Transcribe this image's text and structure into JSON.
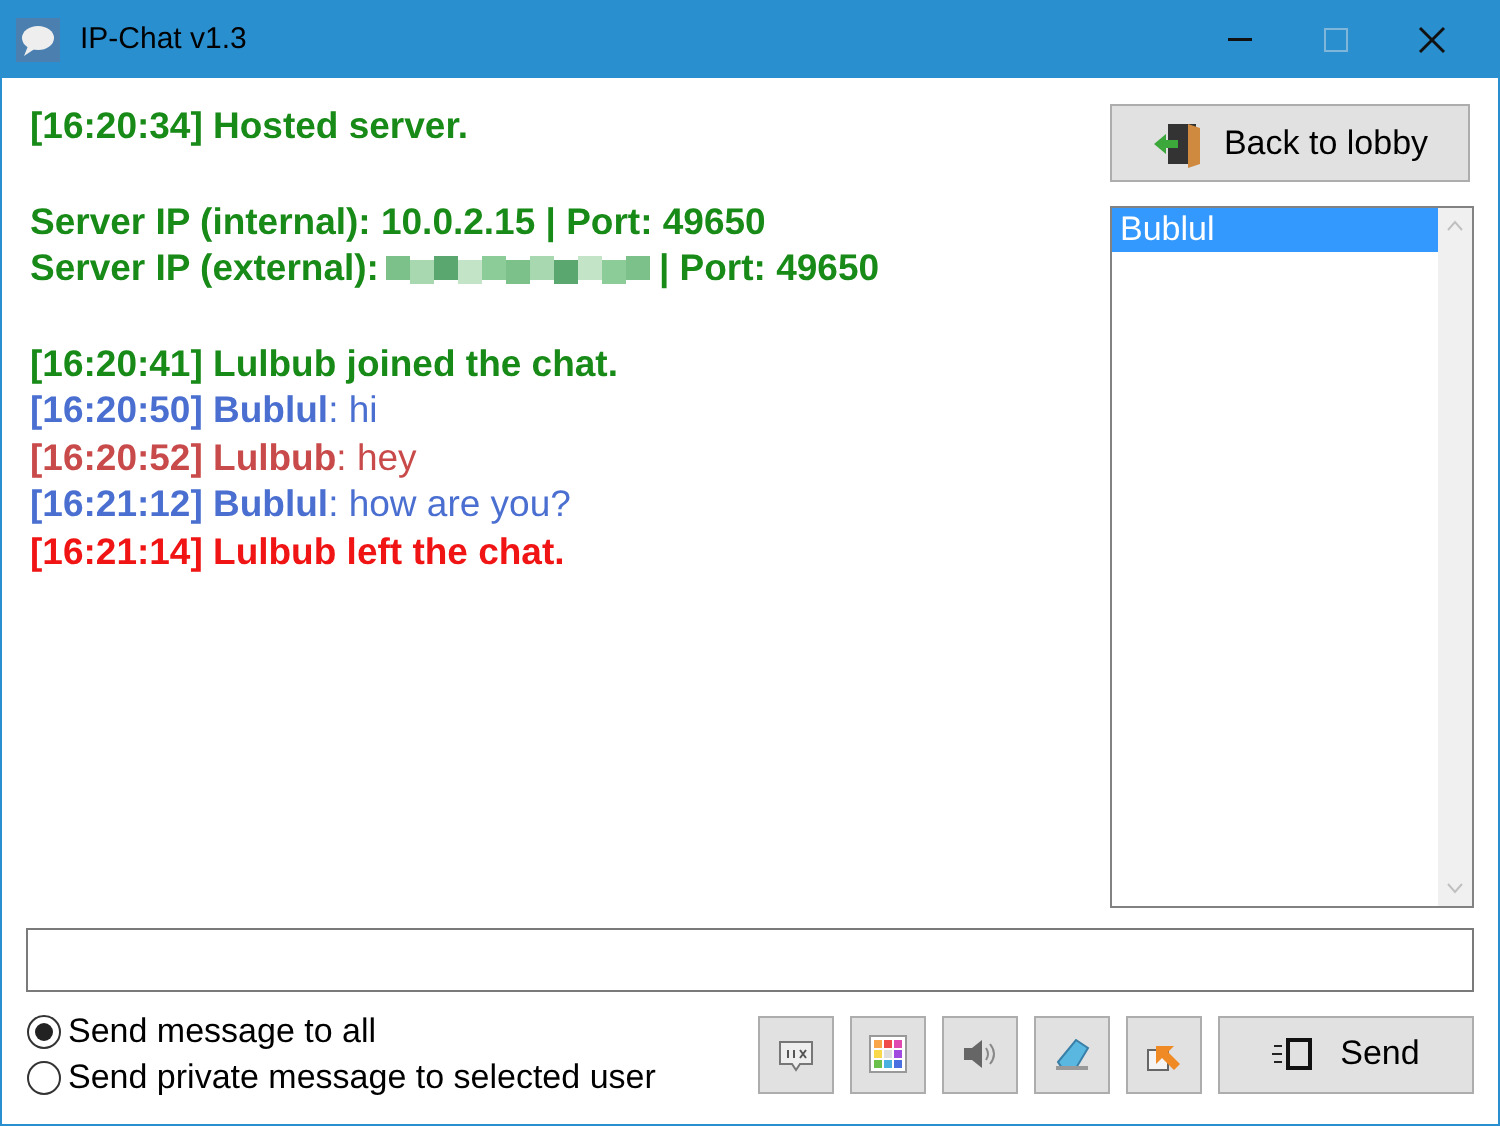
{
  "window": {
    "title": "IP-Chat v1.3"
  },
  "log": [
    [
      {
        "color": "#178a17",
        "segments": [
          {
            "kind": "text",
            "text": "[16:20:34] Hosted server.",
            "bold": true
          }
        ]
      }
    ],
    [
      {
        "color": "#178a17",
        "segments": [
          {
            "kind": "text",
            "text": "Server IP (internal): 10.0.2.15 | Port: 49650",
            "bold": true
          }
        ]
      },
      {
        "color": "#178a17",
        "segments": [
          {
            "kind": "text",
            "text": "Server IP (external):",
            "bold": true
          },
          {
            "kind": "redacted"
          },
          {
            "kind": "text",
            "text": "| Port: 49650",
            "bold": true
          }
        ]
      }
    ],
    [
      {
        "color": "#178a17",
        "segments": [
          {
            "kind": "text",
            "text": "[16:20:41] Lulbub joined the chat.",
            "bold": true
          }
        ]
      },
      {
        "color": "#4a6fd1",
        "segments": [
          {
            "kind": "text",
            "text": "[16:20:50] Bublul",
            "bold": true
          },
          {
            "kind": "text",
            "text": ": hi",
            "bold": false
          }
        ]
      },
      {
        "color": "#c94a4a",
        "segments": [
          {
            "kind": "text",
            "text": "[16:20:52] Lulbub",
            "bold": true
          },
          {
            "kind": "text",
            "text": ": hey",
            "bold": false
          }
        ]
      },
      {
        "color": "#4a6fd1",
        "segments": [
          {
            "kind": "text",
            "text": "[16:21:12] Bublul",
            "bold": true
          },
          {
            "kind": "text",
            "text": ": how are you?",
            "bold": false
          }
        ]
      },
      {
        "color": "#f01414",
        "segments": [
          {
            "kind": "text",
            "text": "[16:21:14] Lulbub left the chat.",
            "bold": true
          }
        ]
      }
    ]
  ],
  "back_button": "Back to lobby",
  "users": [
    {
      "name": "Bublul",
      "selected": true
    }
  ],
  "recipients": [
    {
      "label": "Send message to all",
      "selected": true
    },
    {
      "label": "Send private message to selected user",
      "selected": false
    }
  ],
  "tool_buttons": [
    {
      "kind": "sort"
    },
    {
      "kind": "palette"
    },
    {
      "kind": "sound"
    },
    {
      "kind": "clear"
    },
    {
      "kind": "export"
    }
  ],
  "send_button": "Send"
}
